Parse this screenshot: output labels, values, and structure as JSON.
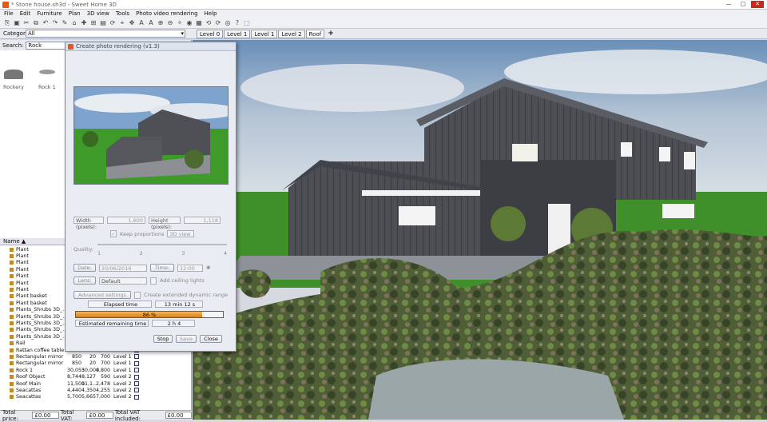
{
  "window": {
    "title": "* Stone house.sh3d - Sweet Home 3D"
  },
  "menu": [
    "File",
    "Edit",
    "Furniture",
    "Plan",
    "3D view",
    "Tools",
    "Photo video rendering",
    "Help"
  ],
  "toolbar": [
    "⎘",
    "▣",
    "✂",
    "⧉",
    "↶",
    "↷",
    "✎",
    "⌂",
    "✚",
    "⊞",
    "▤",
    "⟳",
    "⌖",
    "✥",
    "A",
    "A",
    "⊕",
    "⊖",
    "✧",
    "◉",
    "▦",
    "⟲",
    "⟳",
    "◎",
    "?",
    "⬚"
  ],
  "categorybar": {
    "label": "Category:",
    "value": "All",
    "levels": [
      "Level 0",
      "Level 1",
      "Level 1",
      "Level 2",
      "Roof"
    ],
    "selected_level": 4,
    "add": "+"
  },
  "search": {
    "label": "Search:",
    "value": "Rock"
  },
  "catalog": [
    {
      "name": "Rockery"
    },
    {
      "name": "Rock 1"
    }
  ],
  "furniture": {
    "header": "Name ▲",
    "rows": [
      {
        "name": "Plant",
        "w": "",
        "d": "",
        "h": "",
        "level": ""
      },
      {
        "name": "Plant",
        "w": "",
        "d": "",
        "h": "",
        "level": ""
      },
      {
        "name": "Plant",
        "w": "",
        "d": "",
        "h": "",
        "level": ""
      },
      {
        "name": "Plant",
        "w": "",
        "d": "",
        "h": "",
        "level": ""
      },
      {
        "name": "Plant",
        "w": "",
        "d": "",
        "h": "",
        "level": ""
      },
      {
        "name": "Plant",
        "w": "",
        "d": "",
        "h": "",
        "level": ""
      },
      {
        "name": "Plant",
        "w": "",
        "d": "",
        "h": "",
        "level": ""
      },
      {
        "name": "Plant basket",
        "w": "",
        "d": "",
        "h": "",
        "level": ""
      },
      {
        "name": "Plant basket",
        "w": "",
        "d": "",
        "h": "",
        "level": ""
      },
      {
        "name": "Plants_Shrubs 3D_...",
        "w": "",
        "d": "",
        "h": "",
        "level": ""
      },
      {
        "name": "Plants_Shrubs 3D_...",
        "w": "",
        "d": "",
        "h": "",
        "level": ""
      },
      {
        "name": "Plants_Shrubs 3D_...",
        "w": "",
        "d": "",
        "h": "",
        "level": ""
      },
      {
        "name": "Plants_Shrubs 3D_...",
        "w": "",
        "d": "",
        "h": "",
        "level": ""
      },
      {
        "name": "Plants_Shrubs 3D_...",
        "w": "",
        "d": "",
        "h": "",
        "level": ""
      },
      {
        "name": "Rail",
        "w": "",
        "d": "",
        "h": "",
        "level": ""
      },
      {
        "name": "Rattan coffee table",
        "w": "920",
        "d": "889",
        "h": "1,267",
        "level": "Level 1"
      },
      {
        "name": "Rectangular mirror",
        "w": "850",
        "d": "20",
        "h": "700",
        "level": "Level 1"
      },
      {
        "name": "Rectangular mirror",
        "w": "850",
        "d": "20",
        "h": "700",
        "level": "Level 1"
      },
      {
        "name": "Rock 1",
        "w": "30,055",
        "d": "30,000",
        "h": "4,800",
        "level": "Level 1"
      },
      {
        "name": "Roof Object",
        "w": "8,744",
        "d": "8,127",
        "h": "590",
        "level": "Level 2"
      },
      {
        "name": "Roof Main",
        "w": "11,500",
        "d": "11,1...",
        "h": "2,478",
        "level": "Level 2"
      },
      {
        "name": "Seacattas",
        "w": "4,440",
        "d": "4,350",
        "h": "4,255",
        "level": "Level 2"
      },
      {
        "name": "Seacattas",
        "w": "5,700",
        "d": "5,665",
        "h": "7,000",
        "level": "Level 2"
      }
    ]
  },
  "status": {
    "total_price_label": "Total price:",
    "total_price": "£0.00",
    "vat_label": "Total VAT:",
    "vat": "£0.00",
    "incl_label": "Total VAT included:",
    "incl": "£0.00"
  },
  "dialog": {
    "title": "Create photo rendering (v1.3)",
    "width_label": "Width (pixels):",
    "width": "1,600",
    "height_label": "Height (pixels):",
    "height": "1,118",
    "keep_proportions": "Keep proportions",
    "ratio": "3D view",
    "quality_label": "Quality:",
    "quality_ticks": [
      "1",
      "2",
      "3",
      "4"
    ],
    "date_label": "Date:",
    "date": "20/06/2016",
    "time_label": "Time:",
    "time": "12:00",
    "lens_label": "Lens:",
    "lens": "Default",
    "ceiling_lights": "Add ceiling lights",
    "advanced": "Advanced settings",
    "hdr": "Create extended dynamic range",
    "elapsed_label": "Elapsed time",
    "elapsed": "13 min 12 s",
    "progress_label": "86 %",
    "progress": 0.86,
    "remaining_label": "Estimated remaining time",
    "remaining": "2 h 4",
    "stop": "Stop",
    "save": "Save",
    "close": "Close"
  }
}
